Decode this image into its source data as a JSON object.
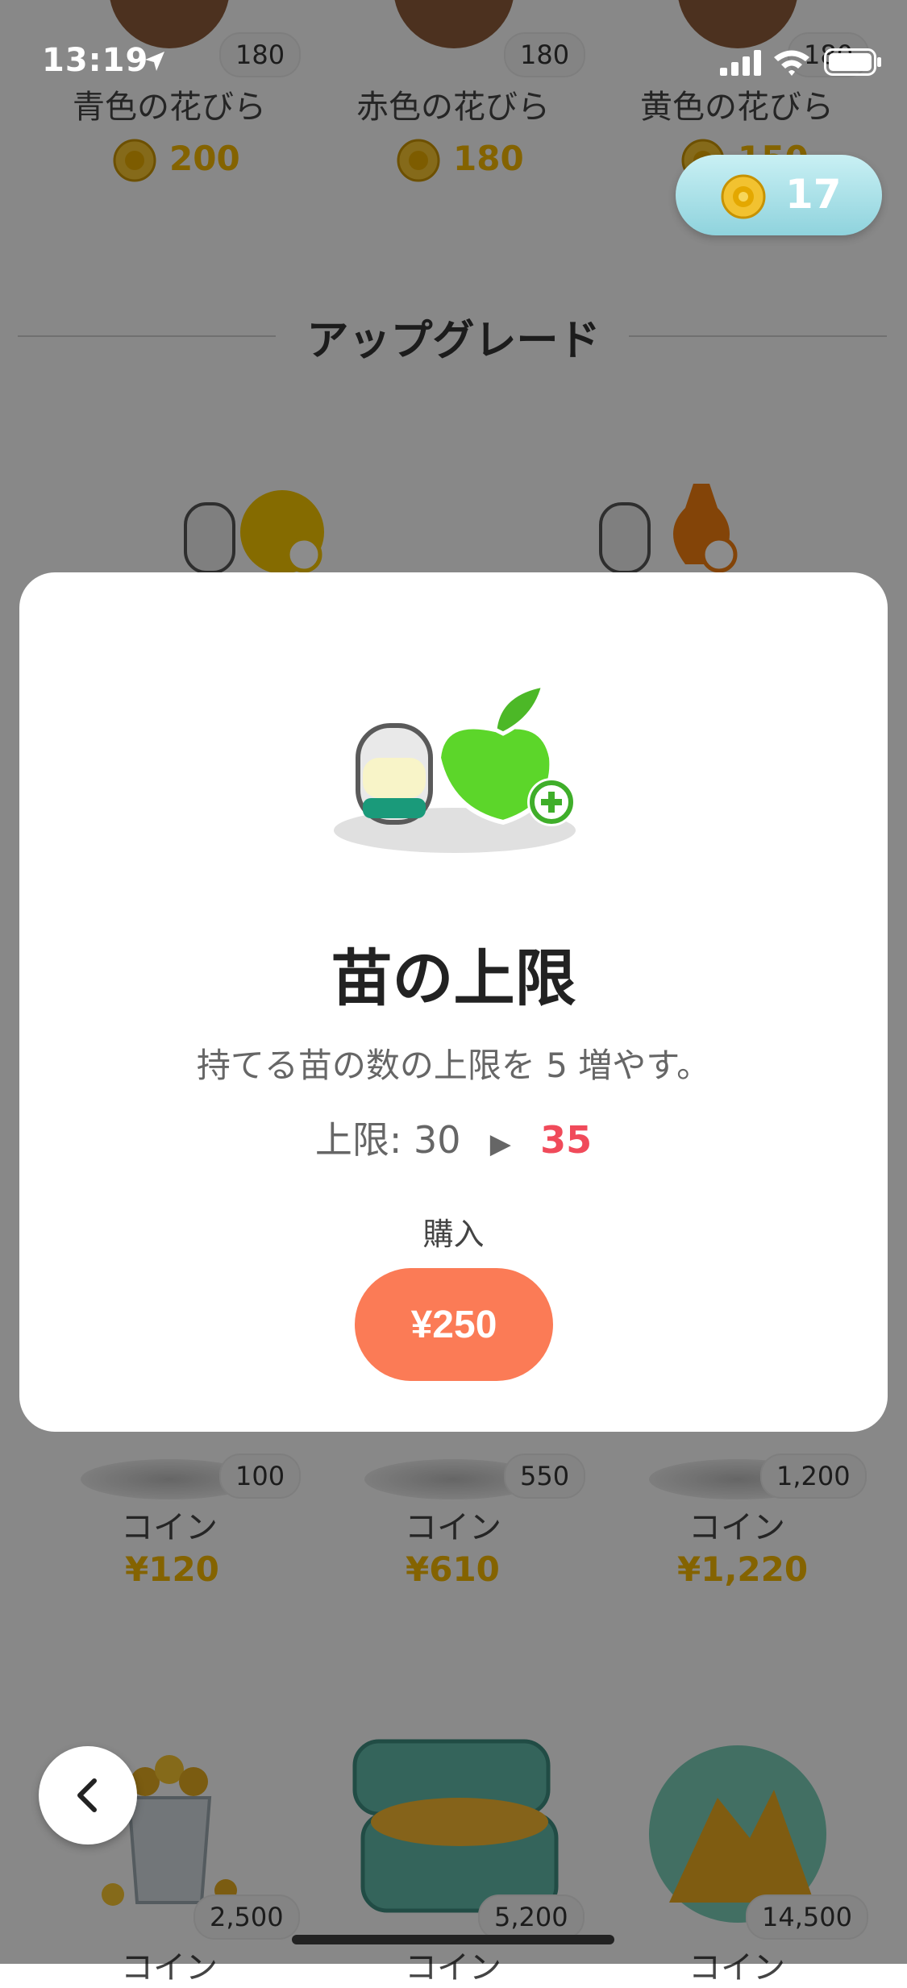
{
  "status_bar": {
    "time": "13:19"
  },
  "balance": {
    "coins": "17"
  },
  "top_items": [
    {
      "name": "青色の花びら",
      "qty": "180",
      "price": "200"
    },
    {
      "name": "赤色の花びら",
      "qty": "180",
      "price": "180"
    },
    {
      "name": "黄色の花びら",
      "qty": "180",
      "price": "150"
    }
  ],
  "section": {
    "title": "アップグレード"
  },
  "modal": {
    "title": "苗の上限",
    "description": "持てる苗の数の上限を 5 増やす。",
    "limit_label": "上限: 30",
    "limit_new": "35",
    "buy_label": "購入",
    "buy_price": "¥250"
  },
  "coin_packs_row1": [
    {
      "name": "コイン",
      "qty": "100",
      "price": "¥120"
    },
    {
      "name": "コイン",
      "qty": "550",
      "price": "¥610"
    },
    {
      "name": "コイン",
      "qty": "1,200",
      "price": "¥1,220"
    }
  ],
  "coin_packs_row2": [
    {
      "name": "コイン",
      "qty": "2,500"
    },
    {
      "name": "コイン",
      "qty": "5,200"
    },
    {
      "name": "コイン",
      "qty": "14,500"
    }
  ],
  "colors": {
    "accent": "#fb7b56",
    "highlight": "#f04a5a",
    "price": "#f0b400",
    "balance": "#8fd3dd"
  },
  "icons": [
    "location-arrow-icon",
    "signal-icon",
    "wifi-icon",
    "battery-icon",
    "coin-icon",
    "chevron-left-icon",
    "plus-icon"
  ]
}
